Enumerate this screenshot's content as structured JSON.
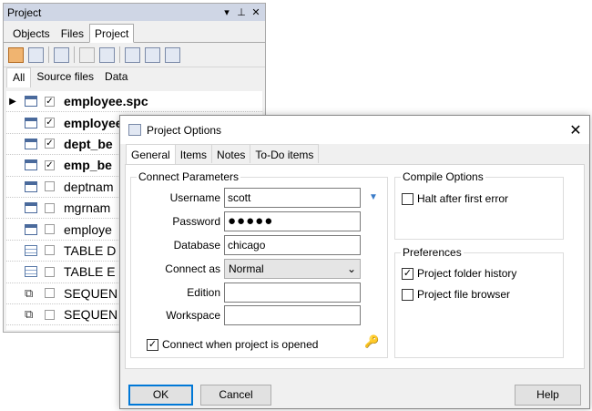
{
  "project_panel": {
    "title": "Project",
    "title_buttons": [
      "▾",
      "⊥",
      "✕"
    ],
    "tabs": [
      {
        "label": "Objects",
        "active": false
      },
      {
        "label": "Files",
        "active": false
      },
      {
        "label": "Project",
        "active": true
      }
    ],
    "subtabs": [
      {
        "label": "All",
        "active": true
      },
      {
        "label": "Source files",
        "active": false
      },
      {
        "label": "Data",
        "active": false
      }
    ],
    "rows": [
      {
        "name": "employee.spc",
        "bold": true,
        "checked": true,
        "icon": "file-icon",
        "current": true
      },
      {
        "name": "employee.bdy",
        "bold": true,
        "checked": true,
        "icon": "file-icon",
        "current": false
      },
      {
        "name": "dept_be",
        "bold": true,
        "checked": true,
        "icon": "file-icon",
        "current": false
      },
      {
        "name": "emp_be",
        "bold": true,
        "checked": true,
        "icon": "file-icon",
        "current": false
      },
      {
        "name": "deptnam",
        "bold": false,
        "checked": false,
        "icon": "file-icon",
        "current": false
      },
      {
        "name": "mgrnam",
        "bold": false,
        "checked": false,
        "icon": "file-icon",
        "current": false
      },
      {
        "name": "employe",
        "bold": false,
        "checked": false,
        "icon": "file-icon",
        "current": false
      },
      {
        "name": "TABLE D",
        "bold": false,
        "checked": false,
        "icon": "table-icon",
        "current": false
      },
      {
        "name": "TABLE E",
        "bold": false,
        "checked": false,
        "icon": "table-icon",
        "current": false
      },
      {
        "name": "SEQUEN",
        "bold": false,
        "checked": false,
        "icon": "sequence-icon",
        "current": false
      },
      {
        "name": "SEQUEN",
        "bold": false,
        "checked": false,
        "icon": "sequence-icon",
        "current": false
      }
    ]
  },
  "dialog": {
    "title": "Project Options",
    "close_glyph": "✕",
    "tabs": [
      {
        "label": "General",
        "active": true
      },
      {
        "label": "Items",
        "active": false
      },
      {
        "label": "Notes",
        "active": false
      },
      {
        "label": "To-Do items",
        "active": false
      }
    ],
    "connect": {
      "legend": "Connect Parameters",
      "username_label": "Username",
      "username_value": "scott",
      "password_label": "Password",
      "password_value": "●●●●●",
      "database_label": "Database",
      "database_value": "chicago",
      "connect_as_label": "Connect as",
      "connect_as_value": "Normal",
      "edition_label": "Edition",
      "edition_value": "",
      "workspace_label": "Workspace",
      "workspace_value": "",
      "connect_when_opened_label": "Connect when project is opened",
      "connect_when_opened_checked": true
    },
    "compile": {
      "legend": "Compile Options",
      "halt_label": "Halt after first error",
      "halt_checked": false
    },
    "preferences": {
      "legend": "Preferences",
      "folder_history_label": "Project folder history",
      "folder_history_checked": true,
      "file_browser_label": "Project file browser",
      "file_browser_checked": false
    },
    "buttons": {
      "ok": "OK",
      "cancel": "Cancel",
      "help": "Help"
    }
  },
  "colors": {
    "accent": "#0078d7",
    "title_bar": "#cfd6e5"
  }
}
